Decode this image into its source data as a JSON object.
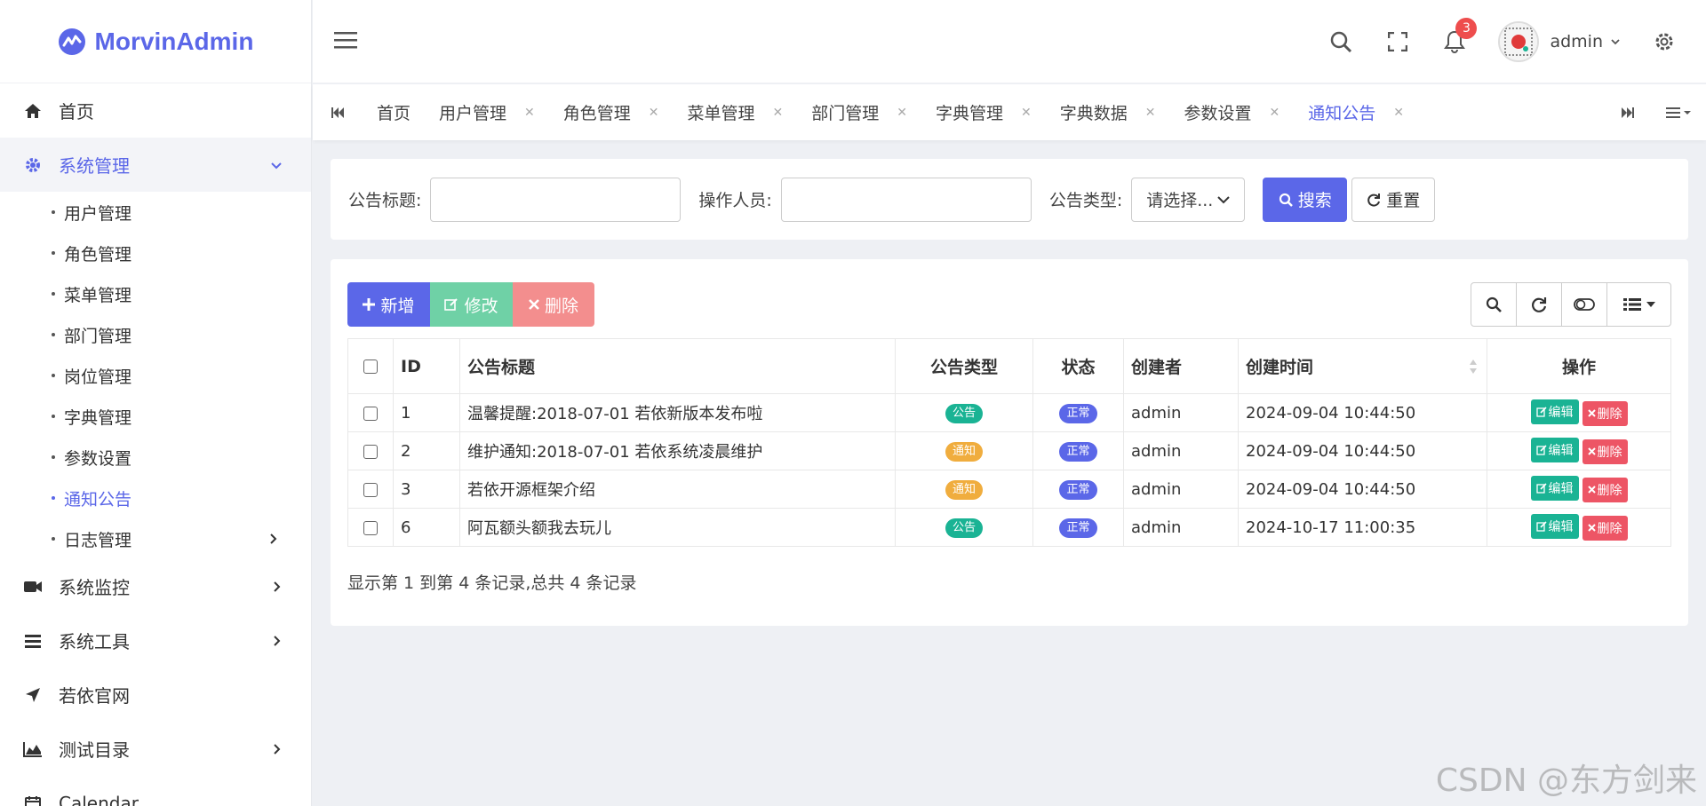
{
  "brand": {
    "name": "MorvinAdmin"
  },
  "sidebar": {
    "items": [
      {
        "label": "首页"
      },
      {
        "label": "系统管理"
      },
      {
        "label": "系统监控"
      },
      {
        "label": "系统工具"
      },
      {
        "label": "若依官网"
      },
      {
        "label": "测试目录"
      },
      {
        "label": "Calendar"
      }
    ],
    "sub": [
      {
        "label": "用户管理"
      },
      {
        "label": "角色管理"
      },
      {
        "label": "菜单管理"
      },
      {
        "label": "部门管理"
      },
      {
        "label": "岗位管理"
      },
      {
        "label": "字典管理"
      },
      {
        "label": "参数设置"
      },
      {
        "label": "通知公告"
      },
      {
        "label": "日志管理"
      }
    ]
  },
  "header": {
    "user": "admin",
    "notifications": "3"
  },
  "tabs": [
    {
      "label": "首页"
    },
    {
      "label": "用户管理"
    },
    {
      "label": "角色管理"
    },
    {
      "label": "菜单管理"
    },
    {
      "label": "部门管理"
    },
    {
      "label": "字典管理"
    },
    {
      "label": "字典数据"
    },
    {
      "label": "参数设置"
    },
    {
      "label": "通知公告"
    }
  ],
  "search": {
    "title_label": "公告标题:",
    "operator_label": "操作人员:",
    "type_label": "公告类型:",
    "type_select": "请选择...",
    "search_btn": "搜索",
    "reset_btn": "重置"
  },
  "toolbar": {
    "add": "新增",
    "edit": "修改",
    "delete": "删除"
  },
  "table": {
    "headers": {
      "id": "ID",
      "title": "公告标题",
      "type": "公告类型",
      "status": "状态",
      "creator": "创建者",
      "time": "创建时间",
      "ops": "操作"
    },
    "rows": [
      {
        "id": "1",
        "title": "温馨提醒:2018-07-01 若依新版本发布啦",
        "type": "公告",
        "status": "正常",
        "creator": "admin",
        "time": "2024-09-04 10:44:50"
      },
      {
        "id": "2",
        "title": "维护通知:2018-07-01 若依系统凌晨维护",
        "type": "通知",
        "status": "正常",
        "creator": "admin",
        "time": "2024-09-04 10:44:50"
      },
      {
        "id": "3",
        "title": "若依开源框架介绍",
        "type": "通知",
        "status": "正常",
        "creator": "admin",
        "time": "2024-09-04 10:44:50"
      },
      {
        "id": "6",
        "title": "阿瓦额头额我去玩儿",
        "type": "公告",
        "status": "正常",
        "creator": "admin",
        "time": "2024-10-17 11:00:35"
      }
    ],
    "op_edit": "编辑",
    "op_delete": "删除",
    "summary": "显示第 1 到第 4 条记录,总共 4 条记录"
  },
  "watermark": "CSDN @东方剑来",
  "colors": {
    "accent": "#5b67e8",
    "green": "#1ab394",
    "orange": "#f0ad3e",
    "red": "#ed5565"
  }
}
